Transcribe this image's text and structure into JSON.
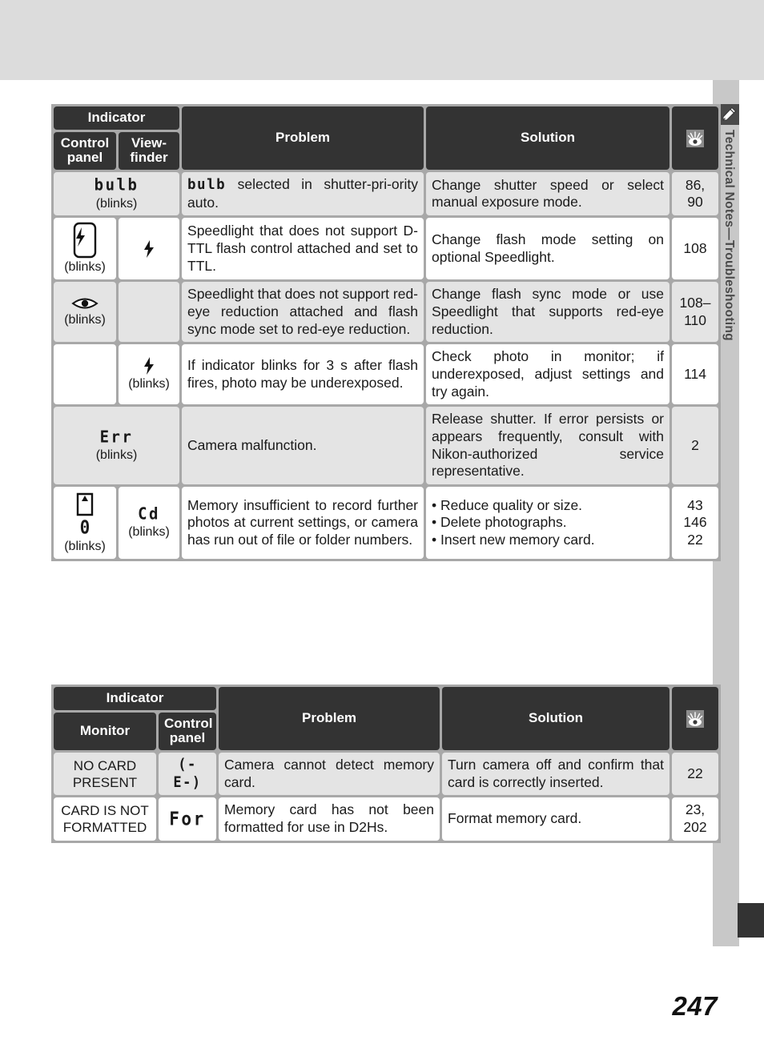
{
  "page": {
    "number": "247",
    "chapter_tab": {
      "label": "Technical Notes—Troubleshooting",
      "icon": "pencil-note-icon"
    }
  },
  "table1": {
    "headers": {
      "group": "Indicator",
      "col1": "Control\npanel",
      "col2": "View-\nfinder",
      "problem": "Problem",
      "solution": "Solution",
      "page_ref_icon": "eye-reference-icon"
    },
    "rows": [
      {
        "control_panel": "bulb",
        "control_panel_type": "lcd",
        "control_panel_note": "(blinks)",
        "viewfinder": "",
        "viewfinder_note": "",
        "problem": "bulb selected in shutter-priority auto.",
        "problem_lcd_prefix": "bulb",
        "problem_rest": "selected in shutter-pri-ority auto.",
        "solution": "Change shutter speed or select manual exposure mode.",
        "page": "86,\n90",
        "shaded": true
      },
      {
        "control_panel": "flash-in-frame-icon",
        "control_panel_type": "icon",
        "control_panel_note": "(blinks)",
        "viewfinder": "flash-icon",
        "viewfinder_note": "",
        "problem": "Speedlight that does not support D-TTL flash control attached and set to TTL.",
        "solution": "Change flash mode setting on optional Speedlight.",
        "page": "108",
        "shaded": false
      },
      {
        "control_panel": "red-eye-icon",
        "control_panel_type": "icon",
        "control_panel_note": "(blinks)",
        "viewfinder": "",
        "viewfinder_note": "",
        "problem": "Speedlight that does not support red-eye reduction attached and flash sync mode set to red-eye reduction.",
        "solution": "Change flash sync mode or use Speedlight that supports red-eye reduction.",
        "page": "108–\n110",
        "shaded": true
      },
      {
        "control_panel": "",
        "control_panel_type": "none",
        "control_panel_note": "",
        "viewfinder": "flash-icon",
        "viewfinder_note": "(blinks)",
        "problem": "If indicator blinks for 3 s after flash fires, photo may be underexposed.",
        "solution": "Check photo in monitor; if underexposed, adjust settings and try again.",
        "page": "114",
        "shaded": false
      },
      {
        "control_panel": "Err",
        "control_panel_type": "lcd",
        "control_panel_note": "(blinks)",
        "viewfinder": "",
        "viewfinder_note": "",
        "problem": "Camera malfunction.",
        "solution": "Release shutter.  If error persists or appears frequently, consult with Nikon-authorized service representative.",
        "page": "2",
        "shaded": true
      },
      {
        "control_panel": "memory-card-zero-icon",
        "control_panel_type": "icon",
        "control_panel_note": "(blinks)",
        "viewfinder": "Cd",
        "viewfinder_type": "lcd",
        "viewfinder_note": "(blinks)",
        "problem": "Memory insufficient to record further photos at current settings, or camera has run out of file or folder numbers.",
        "solution_bullets": [
          "• Reduce quality or size.",
          "• Delete photographs.",
          "• Insert new memory card."
        ],
        "page": "43\n146\n22",
        "shaded": false
      }
    ]
  },
  "table2": {
    "headers": {
      "group": "Indicator",
      "col1": "Monitor",
      "col2": "Control\npanel",
      "problem": "Problem",
      "solution": "Solution",
      "page_ref_icon": "eye-reference-icon"
    },
    "rows": [
      {
        "monitor": "NO CARD\nPRESENT",
        "control_panel": "(-E-)",
        "control_panel_type": "lcd",
        "problem": "Camera cannot detect memory card.",
        "solution": "Turn camera off and confirm that card is correctly inserted.",
        "page": "22",
        "shaded": true
      },
      {
        "monitor": "CARD IS NOT\nFORMATTED",
        "control_panel": "For",
        "control_panel_type": "lcd",
        "problem": "Memory card has not been formatted for use in D2Hs.",
        "solution": "Format memory card.",
        "page": "23,\n202",
        "shaded": false
      }
    ]
  }
}
